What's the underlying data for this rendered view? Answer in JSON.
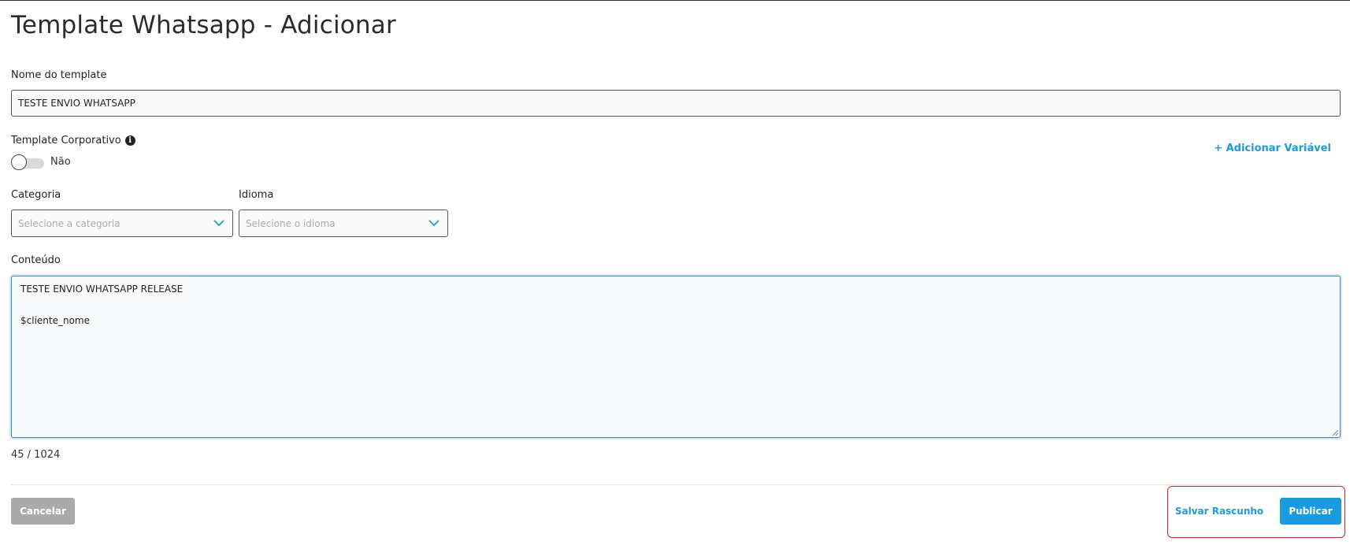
{
  "page": {
    "title": "Template Whatsapp - Adicionar"
  },
  "form": {
    "template_name": {
      "label": "Nome do template",
      "value": "TESTE ENVIO WHATSAPP"
    },
    "corporate": {
      "label": "Template Corporativo",
      "state_text": "Não",
      "enabled": false
    },
    "add_variable_label": "+ Adicionar Variável",
    "category": {
      "label": "Categoria",
      "placeholder": "Selecione a categoria"
    },
    "language": {
      "label": "Idioma",
      "placeholder": "Selecione o idioma"
    },
    "content": {
      "label": "Conteúdo",
      "value": "TESTE ENVIO WHATSAPP RELEASE\n\n$cliente_nome",
      "counter": "45 / 1024"
    }
  },
  "actions": {
    "cancel_label": "Cancelar",
    "save_draft_label": "Salvar Rascunho",
    "publish_label": "Publicar"
  },
  "colors": {
    "accent": "#1a9be0",
    "cancel_bg": "#aaaaaa",
    "highlight": "#e21b1b"
  }
}
